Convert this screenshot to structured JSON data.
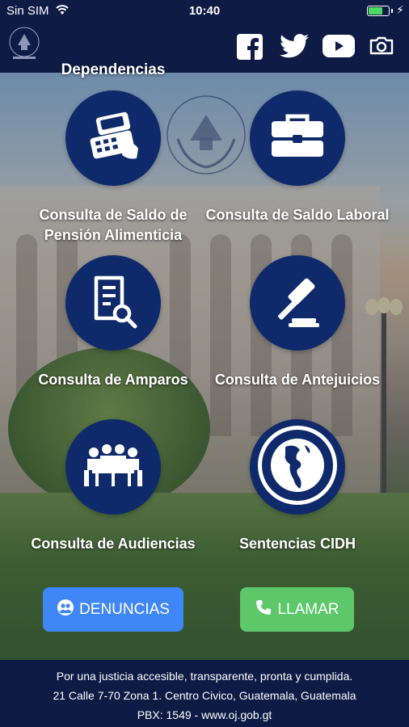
{
  "status_bar": {
    "carrier": "Sin SIM",
    "time": "10:40",
    "battery_level_percent": 70,
    "battery_color": "#4cd964"
  },
  "header": {
    "logo_icon": "organismo-judicial-seal-icon",
    "social": [
      {
        "name": "facebook",
        "icon": "facebook-icon"
      },
      {
        "name": "twitter",
        "icon": "twitter-icon"
      },
      {
        "name": "youtube",
        "icon": "youtube-icon"
      },
      {
        "name": "camera",
        "icon": "camera-icon"
      }
    ]
  },
  "partial_item": {
    "label": "Dependencias"
  },
  "tiles": [
    {
      "label": "Consulta de Saldo de Pensión Alimenticia",
      "icon": "cash-register-icon"
    },
    {
      "label": "Consulta de Saldo Laboral",
      "icon": "briefcase-icon"
    },
    {
      "label": "Consulta de Amparos",
      "icon": "document-search-icon"
    },
    {
      "label": "Consulta de Antejuicios",
      "icon": "gavel-icon"
    },
    {
      "label": "Consulta de Audiencias",
      "icon": "meeting-icon"
    },
    {
      "label": "Sentencias CIDH",
      "icon": "cidh-seal-icon"
    }
  ],
  "actions": {
    "denuncias_label": "DENUNCIAS",
    "llamar_label": "LLAMAR",
    "denuncias_color": "#3f86f7",
    "llamar_color": "#5cc869"
  },
  "footer": {
    "line1": "Por una justicia accesible, transparente, pronta y cumplida.",
    "line2": "21 Calle 7-70 Zona 1. Centro Civico, Guatemala, Guatemala",
    "line3": "PBX: 1549 - www.oj.gob.gt"
  },
  "colors": {
    "navy": "#0d1b45",
    "circle": "#0f2a6b"
  }
}
